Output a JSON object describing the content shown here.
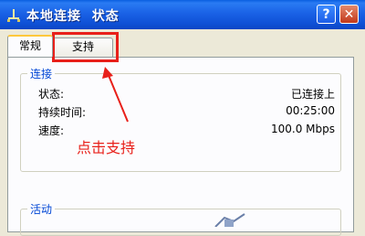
{
  "window": {
    "title": "本地连接  状态",
    "help_glyph": "?",
    "close_glyph": "✕"
  },
  "tabs": [
    {
      "label": "常规",
      "selected": true
    },
    {
      "label": "支持",
      "selected": false
    }
  ],
  "connection": {
    "legend": "连接",
    "rows": [
      {
        "label": "状态:",
        "value": "已连接上"
      },
      {
        "label": "持续时间:",
        "value": "00:25:00"
      },
      {
        "label": "速度:",
        "value": "100.0 Mbps"
      }
    ]
  },
  "activity": {
    "legend": "活动"
  },
  "annotation": {
    "text": "点击支持",
    "color": "#e8201a"
  },
  "icons": {
    "app": "network-connection-icon",
    "activity": "network-activity-icon"
  }
}
